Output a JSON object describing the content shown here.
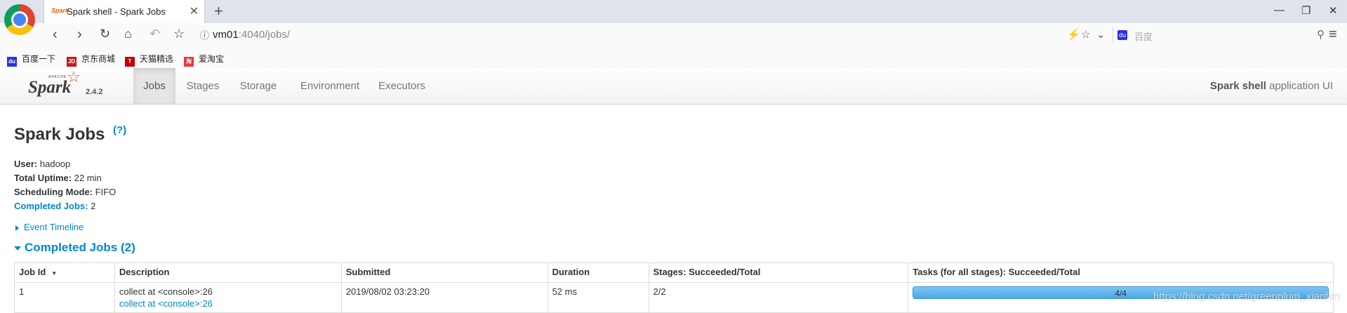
{
  "browser": {
    "tab_title": "Spark shell - Spark Jobs",
    "tab_favicon": "spark-icon",
    "url_host": "vm01",
    "url_rest": ":4040/jobs/",
    "search_placeholder": "百度",
    "bookmarks": [
      {
        "label": "百度一下",
        "icon": "baidu-icon",
        "color": "#2932e1"
      },
      {
        "label": "京东商城",
        "icon": "jd-icon",
        "color": "#c91623"
      },
      {
        "label": "天猫精选",
        "icon": "tmall-icon",
        "color": "#c40000"
      },
      {
        "label": "爱淘宝",
        "icon": "taobao-icon",
        "color": "#e4393c"
      }
    ]
  },
  "spark_nav": {
    "version": "2.4.2",
    "tabs": [
      {
        "label": "Jobs",
        "active": true
      },
      {
        "label": "Stages",
        "active": false
      },
      {
        "label": "Storage",
        "active": false
      },
      {
        "label": "Environment",
        "active": false
      },
      {
        "label": "Executors",
        "active": false
      }
    ],
    "app_name": "Spark shell",
    "app_suffix": "application UI"
  },
  "page": {
    "title": "Spark Jobs",
    "help": "(?)",
    "user_label": "User:",
    "user_value": "hadoop",
    "uptime_label": "Total Uptime:",
    "uptime_value": "22 min",
    "sched_label": "Scheduling Mode:",
    "sched_value": "FIFO",
    "completed_label": "Completed Jobs:",
    "completed_value": "2",
    "event_timeline": "Event Timeline",
    "completed_heading": "Completed Jobs (2)"
  },
  "table": {
    "headers": [
      "Job Id",
      "Description",
      "Submitted",
      "Duration",
      "Stages: Succeeded/Total",
      "Tasks (for all stages): Succeeded/Total"
    ],
    "rows": [
      {
        "job_id": "1",
        "description": "collect at <console>:26",
        "description_link": "collect at <console>:26",
        "submitted": "2019/08/02 03:23:20",
        "duration": "52 ms",
        "stages": "2/2",
        "tasks_label": "4/4",
        "tasks_fraction": 1.0
      }
    ]
  },
  "watermark": "https://blog.csdn.net/greenplum_xiaofan",
  "colors": {
    "accent": "#0088cc",
    "spark_orange": "#e25a1c",
    "progress_fill": "#4aa8e6"
  }
}
